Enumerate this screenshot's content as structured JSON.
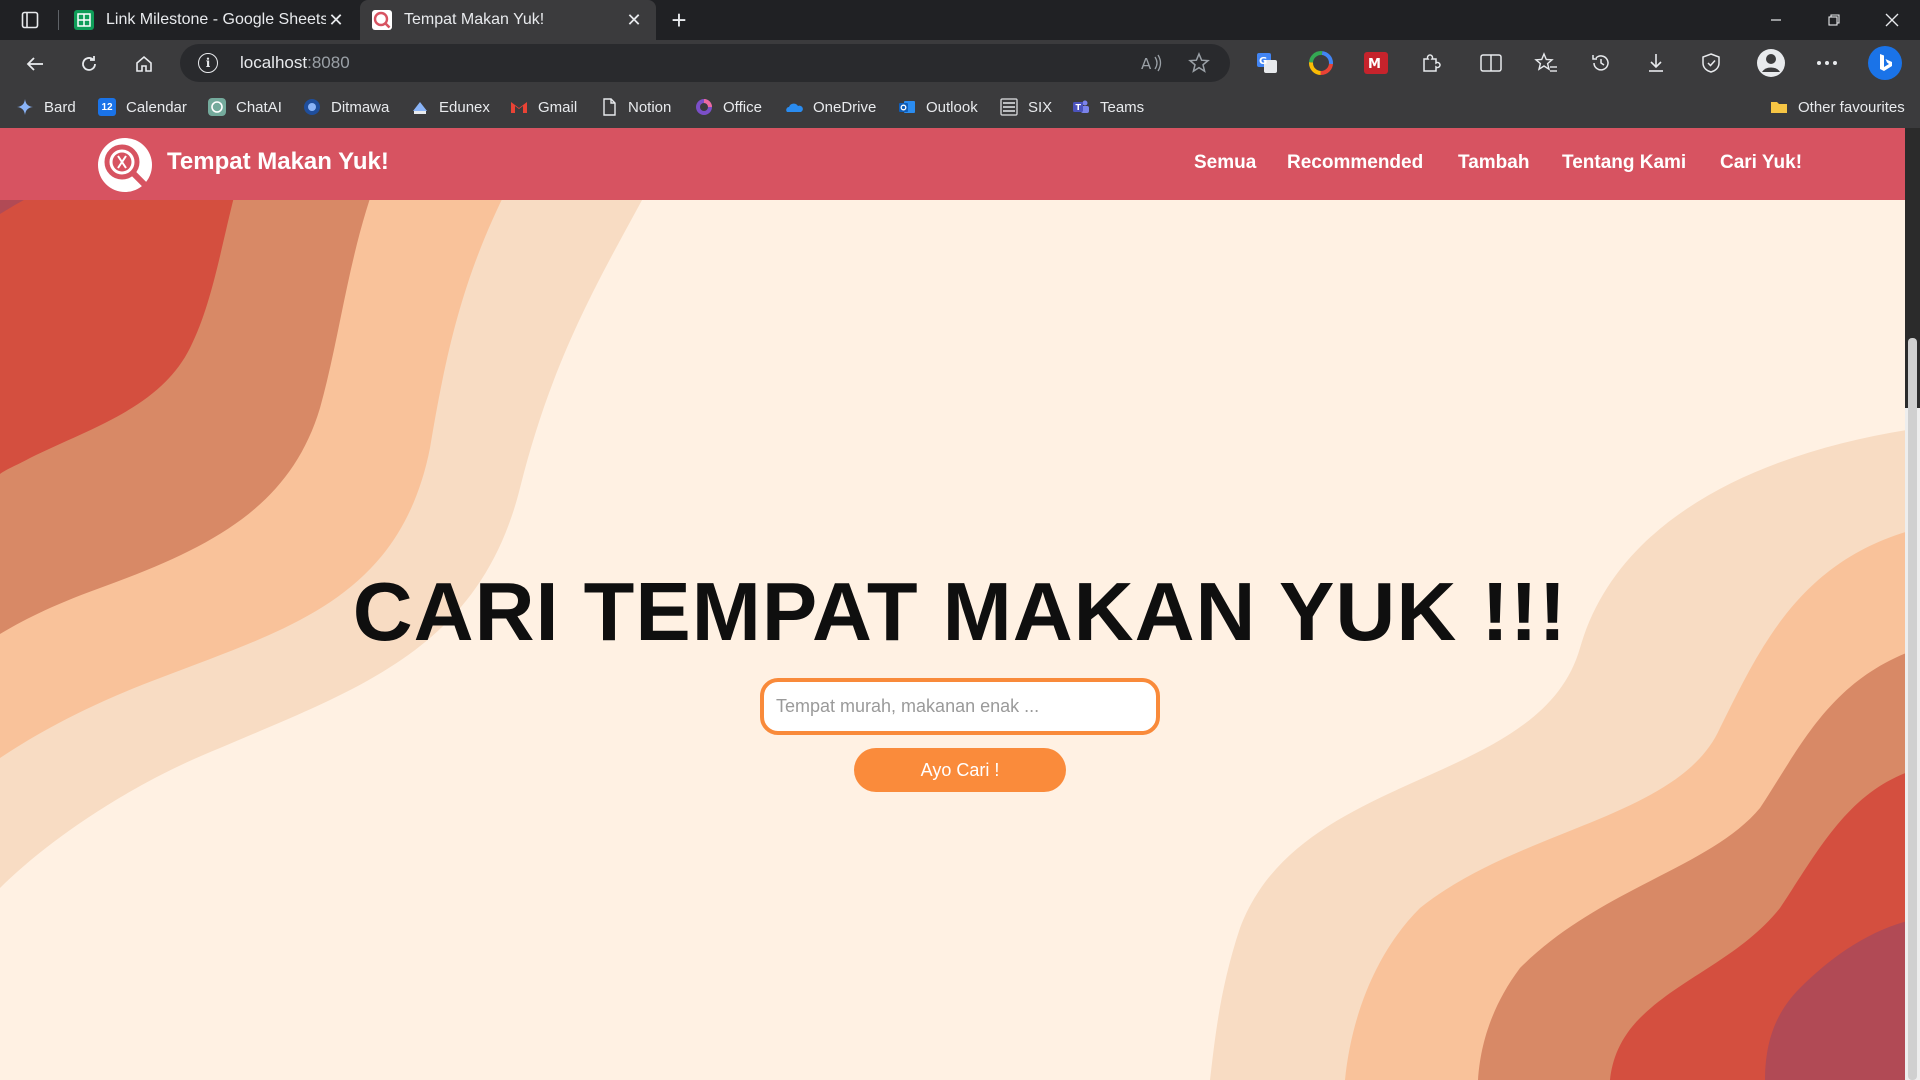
{
  "browser": {
    "tabs": [
      {
        "title": "Link Milestone - Google Sheets",
        "active": false
      },
      {
        "title": "Tempat Makan Yuk!",
        "active": true
      }
    ],
    "address": {
      "host": "localhost",
      "port": ":8080"
    },
    "bookmarks": [
      "Bard",
      "Calendar",
      "ChatAI",
      "Ditmawa",
      "Edunex",
      "Gmail",
      "Notion",
      "Office",
      "OneDrive",
      "Outlook",
      "SIX",
      "Teams"
    ],
    "other_favourites": "Other favourites",
    "calendar_badge": "12"
  },
  "site": {
    "brand": "Tempat Makan Yuk!",
    "nav": [
      "Semua",
      "Recommended",
      "Tambah",
      "Tentang Kami",
      "Cari Yuk!"
    ],
    "hero_title": "CARI TEMPAT MAKAN YUK !!!",
    "search_placeholder": "Tempat murah, makanan enak ...",
    "search_button": "Ayo Cari !"
  },
  "colors": {
    "navbar": "#d75361",
    "accent": "#fa8b3b",
    "page_bg": "#fff1e3",
    "wave_1": "#b14a55",
    "wave_2": "#d44f3f",
    "wave_3": "#d88966",
    "wave_4": "#f9c29a",
    "wave_5": "#f8dcc3"
  }
}
